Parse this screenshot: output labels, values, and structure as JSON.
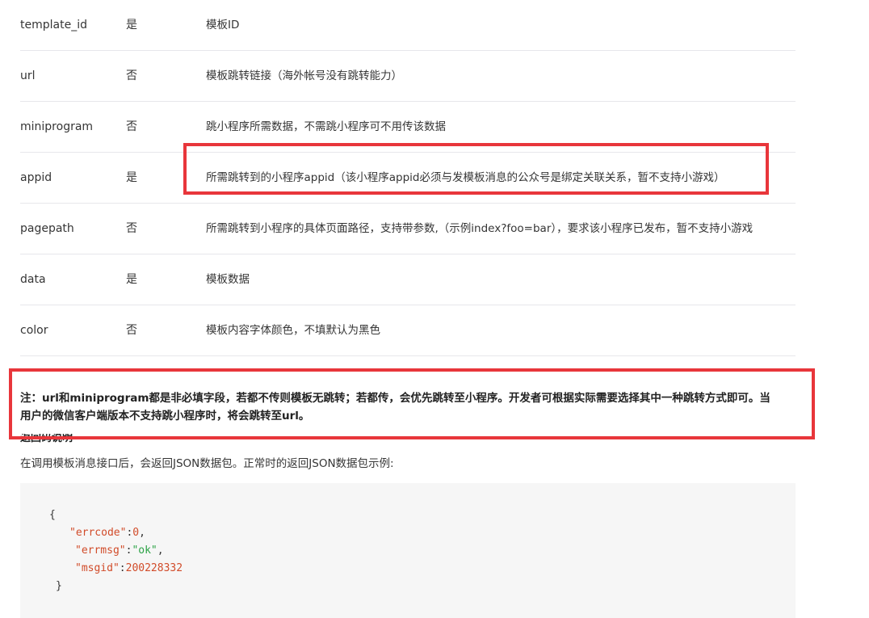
{
  "params": [
    {
      "name": "template_id",
      "required": "是",
      "description": "模板ID"
    },
    {
      "name": "url",
      "required": "否",
      "description": "模板跳转链接（海外帐号没有跳转能力）"
    },
    {
      "name": "miniprogram",
      "required": "否",
      "description": "跳小程序所需数据，不需跳小程序可不用传该数据"
    },
    {
      "name": "appid",
      "required": "是",
      "description": "所需跳转到的小程序appid（该小程序appid必须与发模板消息的公众号是绑定关联关系，暂不支持小游戏）"
    },
    {
      "name": "pagepath",
      "required": "否",
      "description": "所需跳转到小程序的具体页面路径，支持带参数,（示例index?foo=bar），要求该小程序已发布，暂不支持小游戏"
    },
    {
      "name": "data",
      "required": "是",
      "description": "模板数据"
    },
    {
      "name": "color",
      "required": "否",
      "description": "模板内容字体颜色，不填默认为黑色"
    }
  ],
  "note": {
    "line1": "注：url和miniprogram都是非必填字段，若都不传则模板无跳转；若都传，会优先跳转至小程序。开发者可根据实际需要选择其中一种跳转方式即可。当",
    "line2": "用户的微信客户端版本不支持跳小程序时，将会跳转至url。"
  },
  "return_section": {
    "title": "返回码说明",
    "intro": "在调用模板消息接口后，会返回JSON数据包。正常时的返回JSON数据包示例:"
  },
  "code": {
    "open_brace": "{",
    "close_brace": "}",
    "fields": [
      {
        "key": "\"errcode\"",
        "colon": ":",
        "value": "0",
        "suffix": ",",
        "type": "num"
      },
      {
        "key": "\"errmsg\"",
        "colon": ":",
        "value": "\"ok\"",
        "suffix": ",",
        "type": "str"
      },
      {
        "key": "\"msgid\"",
        "colon": ":",
        "value": "200228332",
        "suffix": "",
        "type": "num"
      }
    ]
  },
  "colors": {
    "highlight": "#e8363b",
    "code_key": "#d14b29",
    "code_string": "#2ba245",
    "code_background": "#f6f6f6",
    "row_divider": "#e7e7eb"
  }
}
